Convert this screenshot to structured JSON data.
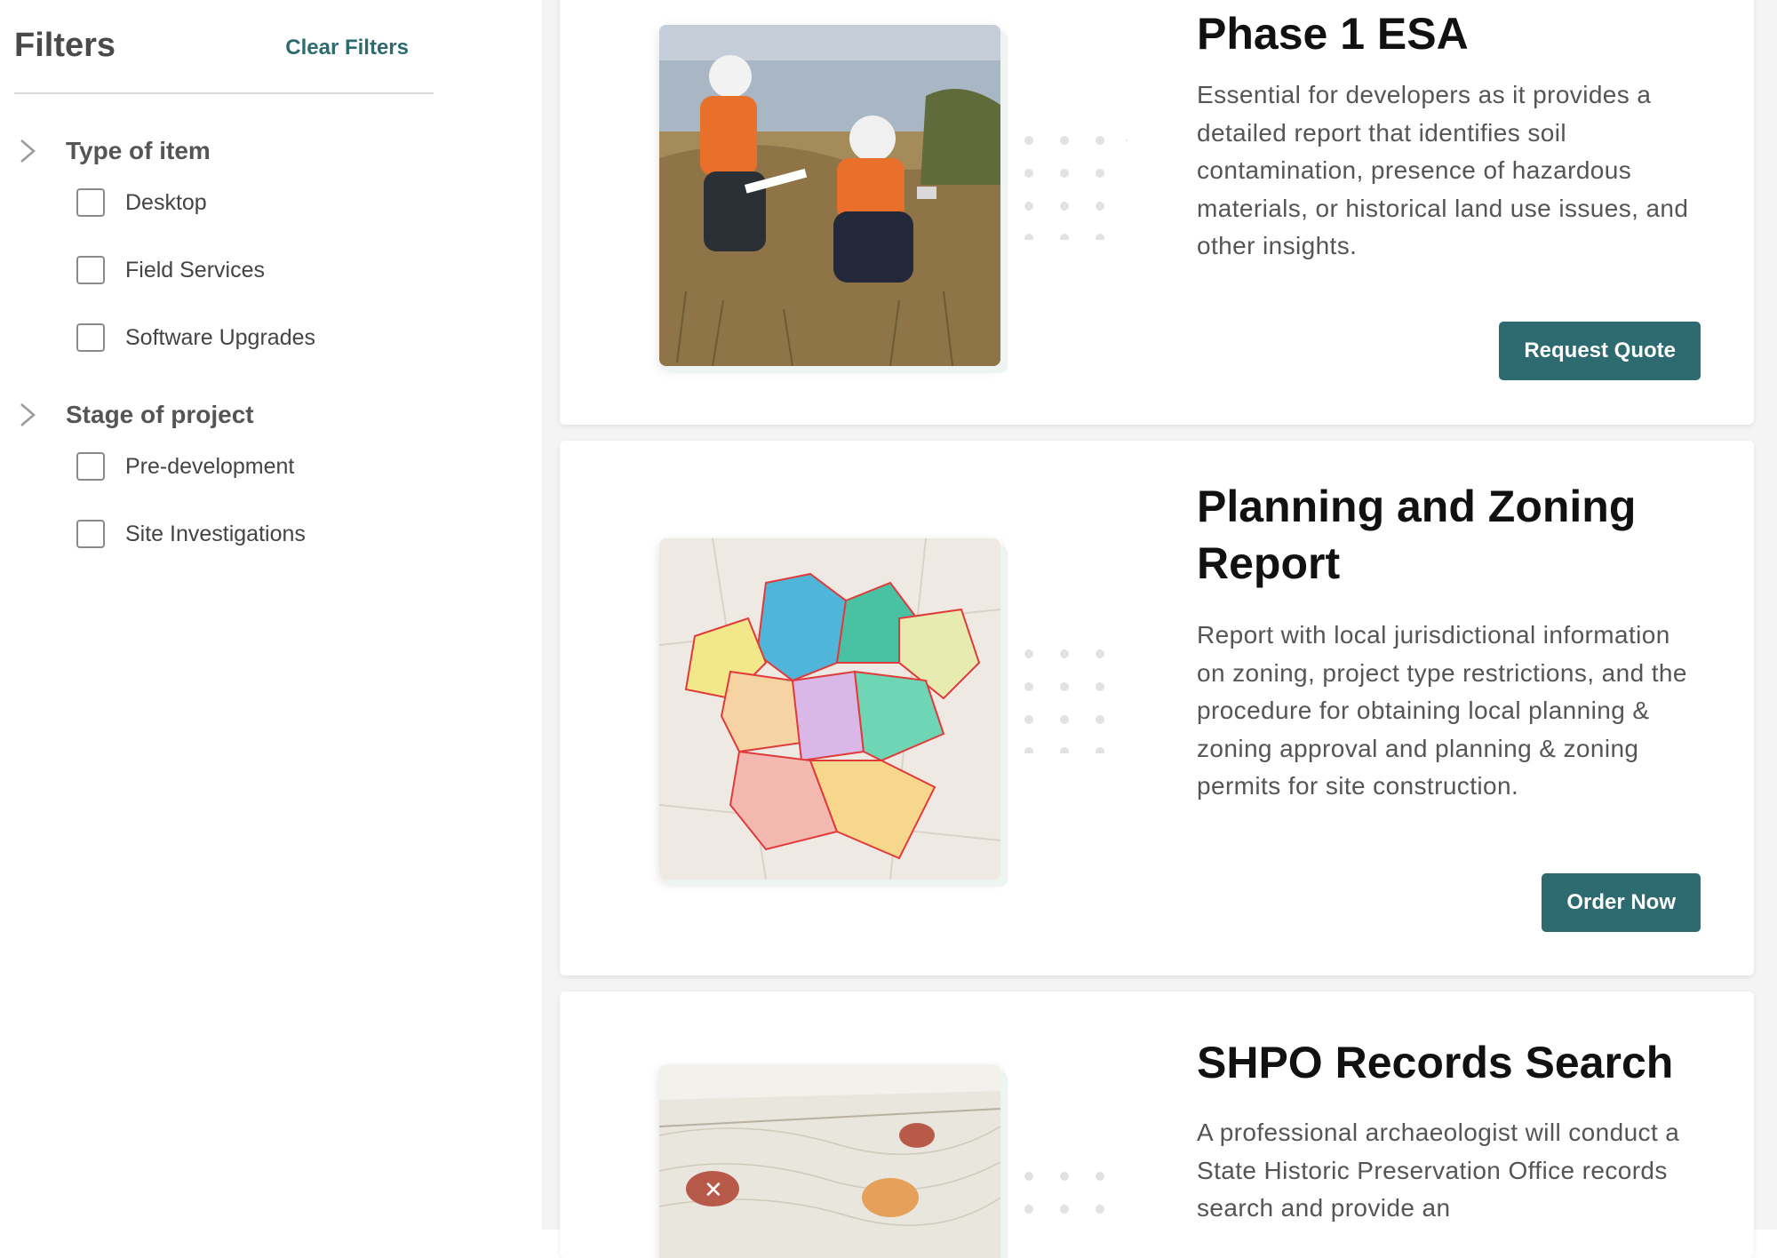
{
  "sidebar": {
    "title": "Filters",
    "clear_label": "Clear Filters",
    "groups": [
      {
        "label": "Type of item",
        "options": [
          {
            "label": "Desktop"
          },
          {
            "label": "Field Services"
          },
          {
            "label": "Software Upgrades"
          }
        ]
      },
      {
        "label": "Stage of project",
        "options": [
          {
            "label": "Pre-development"
          },
          {
            "label": "Site Investigations"
          }
        ]
      }
    ]
  },
  "cards": [
    {
      "title": "Phase 1 ESA",
      "description": "Essential for developers as it provides a detailed report that identifies soil contamination, presence of hazardous materials, or historical land use issues, and other insights.",
      "button": "Request Quote",
      "image_icon": "field-workers-photo"
    },
    {
      "title": "Planning and Zoning Report",
      "description": "Report with local jurisdictional information on zoning, project type restrictions, and the procedure for obtaining local planning & zoning approval and planning & zoning permits for site construction.",
      "button": "Order Now",
      "image_icon": "zoning-map"
    },
    {
      "title": "SHPO Records Search",
      "description": "A professional archaeologist will conduct a State Historic Preservation Office records search and provide an",
      "image_icon": "topographic-map"
    }
  ],
  "colors": {
    "accent": "#2e6b70",
    "page_bg": "#f4f4f4"
  }
}
